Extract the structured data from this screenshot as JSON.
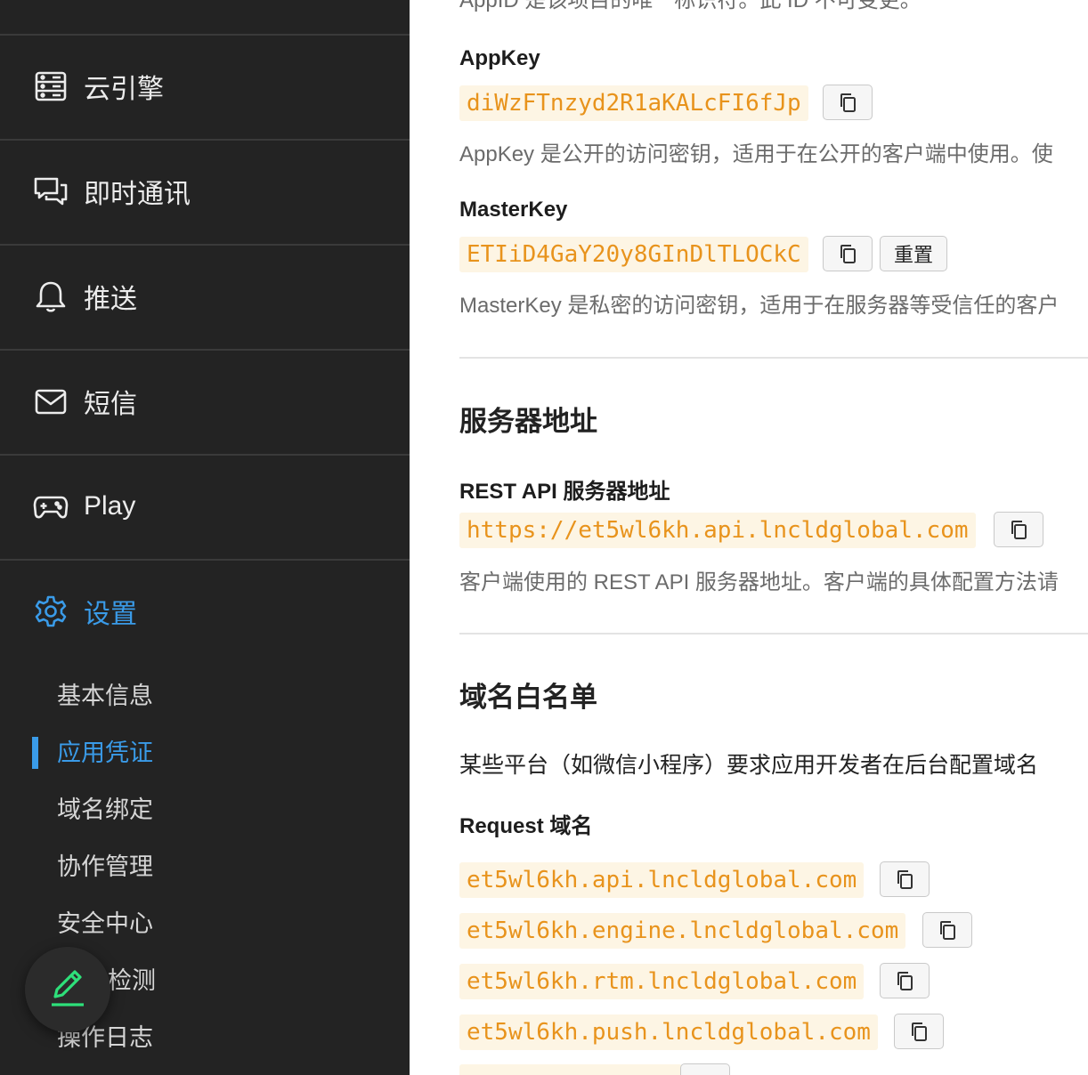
{
  "sidebar": {
    "nav": [
      {
        "label": "云引擎",
        "icon": "server-icon"
      },
      {
        "label": "即时通讯",
        "icon": "chat-icon"
      },
      {
        "label": "推送",
        "icon": "bell-icon"
      },
      {
        "label": "短信",
        "icon": "mail-icon"
      },
      {
        "label": "Play",
        "icon": "gamepad-icon"
      },
      {
        "label": "设置",
        "icon": "gear-icon",
        "active": true
      }
    ],
    "sub_items": [
      "基本信息",
      "应用凭证",
      "域名绑定",
      "协作管理",
      "安全中心",
      "检测",
      "操作日志"
    ],
    "active_sub": "应用凭证",
    "accent": "#3a9be8"
  },
  "main": {
    "top_clipped_text": "AppID 是该项目的唯一标识符。此 ID 不可变更。",
    "appkey": {
      "label": "AppKey",
      "value": "diWzFTnzyd2R1aKALcFI6fJp",
      "desc": "AppKey 是公开的访问密钥，适用于在公开的客户端中使用。使"
    },
    "masterkey": {
      "label": "MasterKey",
      "value": "ETIiD4GaY20y8GInDlTLOCkC",
      "reset_label": "重置",
      "desc": "MasterKey 是私密的访问密钥，适用于在服务器等受信任的客户"
    },
    "server": {
      "title": "服务器地址",
      "rest_label": "REST API 服务器地址",
      "rest_url": "https://et5wl6kh.api.lncldglobal.com",
      "rest_desc": "客户端使用的 REST API 服务器地址。客户端的具体配置方法请"
    },
    "whitelist": {
      "title": "域名白名单",
      "desc": "某些平台（如微信小程序）要求应用开发者在后台配置域名",
      "request_label": "Request 域名",
      "domains": [
        "et5wl6kh.api.lncldglobal.com",
        "et5wl6kh.engine.lncldglobal.com",
        "et5wl6kh.rtm.lncldglobal.com",
        "et5wl6kh.push.lncldglobal.com"
      ]
    }
  }
}
